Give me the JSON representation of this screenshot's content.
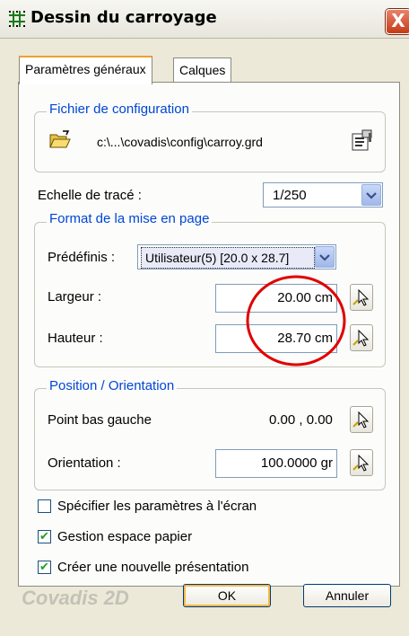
{
  "window": {
    "title": "Dessin du carroyage",
    "close_glyph": "X",
    "icon": "grid-icon"
  },
  "tabs": [
    {
      "label": "Paramètres généraux",
      "active": true
    },
    {
      "label": "Calques",
      "active": false
    }
  ],
  "config": {
    "legend": "Fichier de configuration",
    "path": "c:\\...\\covadis\\config\\carroy.grd",
    "open_icon": "open-folder-icon",
    "edit_icon": "properties-icon"
  },
  "scale": {
    "label": "Echelle de tracé :",
    "value": "1/250"
  },
  "format": {
    "legend": "Format de la mise en page",
    "predefined_label": "Prédéfinis :",
    "predefined_value": "Utilisateur(5) [20.0 x 28.7]",
    "width_label": "Largeur :",
    "width_value": "20.00 cm",
    "height_label": "Hauteur :",
    "height_value": "28.70 cm"
  },
  "position": {
    "legend": "Position / Orientation",
    "point_label": "Point bas gauche",
    "point_value": "0.00 , 0.00",
    "orientation_label": "Orientation :",
    "orientation_value": "100.0000 gr"
  },
  "options": [
    {
      "label": "Spécifier les paramètres à l'écran",
      "checked": false
    },
    {
      "label": "Gestion espace papier",
      "checked": true
    },
    {
      "label": "Créer une nouvelle présentation",
      "checked": true
    }
  ],
  "footer": {
    "brand": "Covadis 2D",
    "ok_label": "OK",
    "cancel_label": "Annuler"
  },
  "colors": {
    "accent": "#0046d5",
    "annotation": "#e00000",
    "check": "#21a121"
  }
}
